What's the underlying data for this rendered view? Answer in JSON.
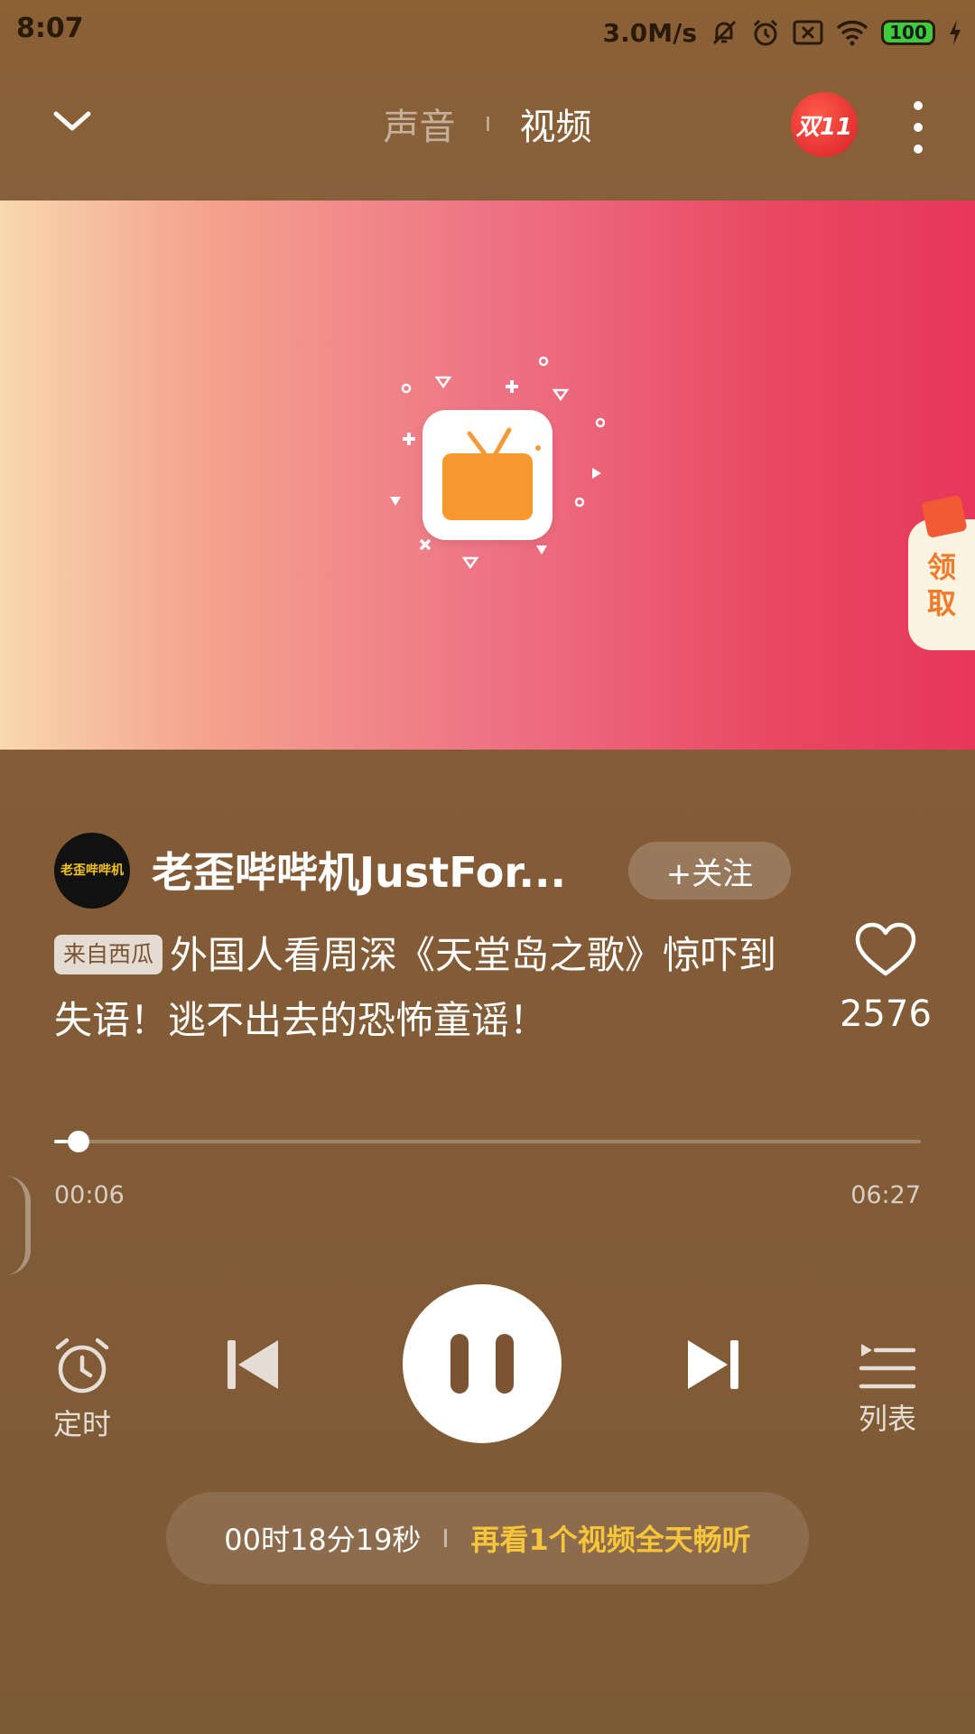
{
  "status_bar": {
    "time": "8:07",
    "speed": "3.0M/s",
    "battery": "100"
  },
  "header": {
    "tabs": [
      {
        "label": "声音",
        "active": false
      },
      {
        "label": "视频",
        "active": true
      }
    ],
    "promo_badge": "双11"
  },
  "video": {
    "claim_label_1": "领",
    "claim_label_2": "取"
  },
  "creator": {
    "avatar_text": "老歪哔哔机",
    "name": "老歪哔哔机JustFor...",
    "follow_label": "+关注"
  },
  "track": {
    "source_tag": "来自西瓜",
    "title": "外国人看周深《天堂岛之歌》惊吓到失语！逃不出去的恐怖童谣！",
    "like_count": "2576"
  },
  "progress": {
    "current": "00:06",
    "total": "06:27",
    "fraction": 0.0155
  },
  "controls": {
    "timer_label": "定时",
    "list_label": "列表"
  },
  "bottom_bar": {
    "countdown": "00时18分19秒",
    "cta": "再看1个视频全天畅听"
  },
  "colors": {
    "background": "#835c37",
    "accent_cta": "#f7c53a",
    "video_left": "#f8d8ae",
    "video_right": "#e8375a"
  }
}
